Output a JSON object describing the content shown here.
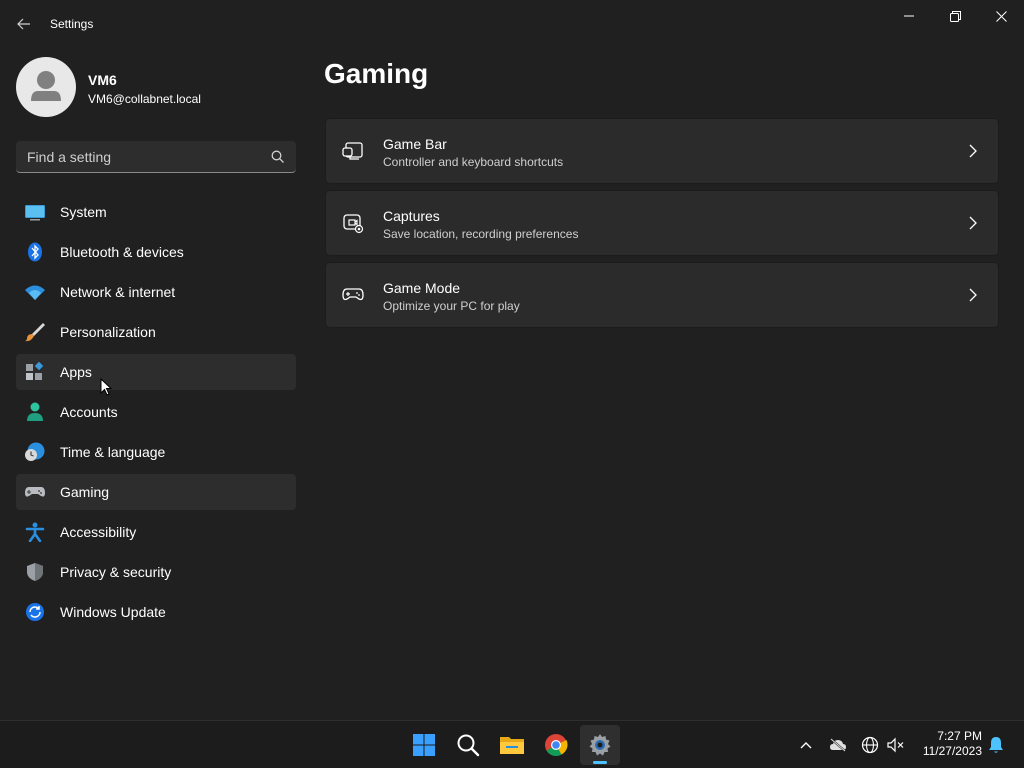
{
  "window": {
    "title": "Settings",
    "controls": [
      "minimize",
      "maximize",
      "close"
    ]
  },
  "profile": {
    "name": "VM6",
    "email": "VM6@collabnet.local"
  },
  "search": {
    "placeholder": "Find a setting"
  },
  "sidebar": {
    "items": [
      {
        "label": "System",
        "icon": "system-icon"
      },
      {
        "label": "Bluetooth & devices",
        "icon": "bluetooth-icon"
      },
      {
        "label": "Network & internet",
        "icon": "wifi-icon"
      },
      {
        "label": "Personalization",
        "icon": "brush-icon"
      },
      {
        "label": "Apps",
        "icon": "apps-icon",
        "state": "hover"
      },
      {
        "label": "Accounts",
        "icon": "person-icon"
      },
      {
        "label": "Time & language",
        "icon": "globe-clock-icon"
      },
      {
        "label": "Gaming",
        "icon": "gamepad-icon",
        "state": "selected"
      },
      {
        "label": "Accessibility",
        "icon": "accessibility-icon"
      },
      {
        "label": "Privacy & security",
        "icon": "shield-icon"
      },
      {
        "label": "Windows Update",
        "icon": "update-icon"
      }
    ]
  },
  "main": {
    "title": "Gaming",
    "cards": [
      {
        "title": "Game Bar",
        "subtitle": "Controller and keyboard shortcuts",
        "icon": "game-bar-icon"
      },
      {
        "title": "Captures",
        "subtitle": "Save location, recording preferences",
        "icon": "capture-icon"
      },
      {
        "title": "Game Mode",
        "subtitle": "Optimize your PC for play",
        "icon": "gamepad-icon"
      }
    ]
  },
  "taskbar": {
    "apps": [
      "start-icon",
      "search-icon",
      "file-explorer-icon",
      "chrome-icon",
      "settings-icon"
    ],
    "active_app": "settings-icon",
    "tray": [
      "chevron-up-icon",
      "onedrive-offline-icon",
      "network-icon",
      "volume-muted-icon",
      "notification-bell-icon"
    ],
    "time": "7:27 PM",
    "date": "11/27/2023"
  },
  "colors": {
    "background": "#202020",
    "card": "#2b2b2b",
    "accent": "#4cc2ff",
    "taskbar": "#1c1c1c"
  }
}
